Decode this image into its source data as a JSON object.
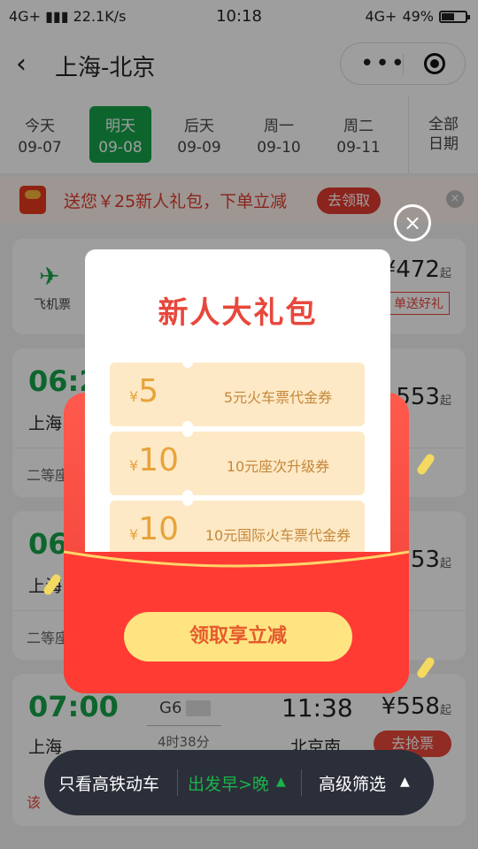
{
  "status": {
    "network": "4G+",
    "speed": "22.1K/s",
    "time": "10:18",
    "net2": "4G+",
    "battery": "49%"
  },
  "header": {
    "title": "上海-北京",
    "more": "•••"
  },
  "dates": [
    {
      "label": "今天",
      "date": "09-07"
    },
    {
      "label": "明天",
      "date": "09-08"
    },
    {
      "label": "后天",
      "date": "09-09"
    },
    {
      "label": "周一",
      "date": "09-10"
    },
    {
      "label": "周二",
      "date": "09-11"
    }
  ],
  "all_dates": {
    "l1": "全部",
    "l2": "日期"
  },
  "promo": {
    "text": "送您￥25新人礼包，下单立减",
    "button": "去领取",
    "close": "×"
  },
  "flight_card": {
    "label": "飞机票",
    "price": "472",
    "price_suffix": "起",
    "tag": "单送好礼"
  },
  "trains": [
    {
      "time": "06:2",
      "from": "上海",
      "price": "553",
      "suffix": "起",
      "seat": "二等座"
    },
    {
      "time": "06",
      "from": "上海",
      "price": "53",
      "suffix": "起",
      "seat": "二等座"
    },
    {
      "time": "07:00",
      "train": "G6",
      "duration": "4时38分",
      "arrive": "11:38",
      "from": "上海",
      "to": "北京南",
      "price": "558",
      "suffix": "起",
      "button": "去抢票",
      "note": "该"
    }
  ],
  "bottom_bar": {
    "filter_hsr": "只看高铁动车",
    "sort": "出发早>晚",
    "advanced": "高级筛选"
  },
  "modal": {
    "title": "新人大礼包",
    "coupons": [
      {
        "amount": "5",
        "desc": "5元火车票代金券"
      },
      {
        "amount": "10",
        "desc": "10元座次升级券"
      },
      {
        "amount": "10",
        "desc": "10元国际火车票代金券"
      }
    ],
    "currency": "¥",
    "claim_button": "领取享立减",
    "close": "×"
  }
}
